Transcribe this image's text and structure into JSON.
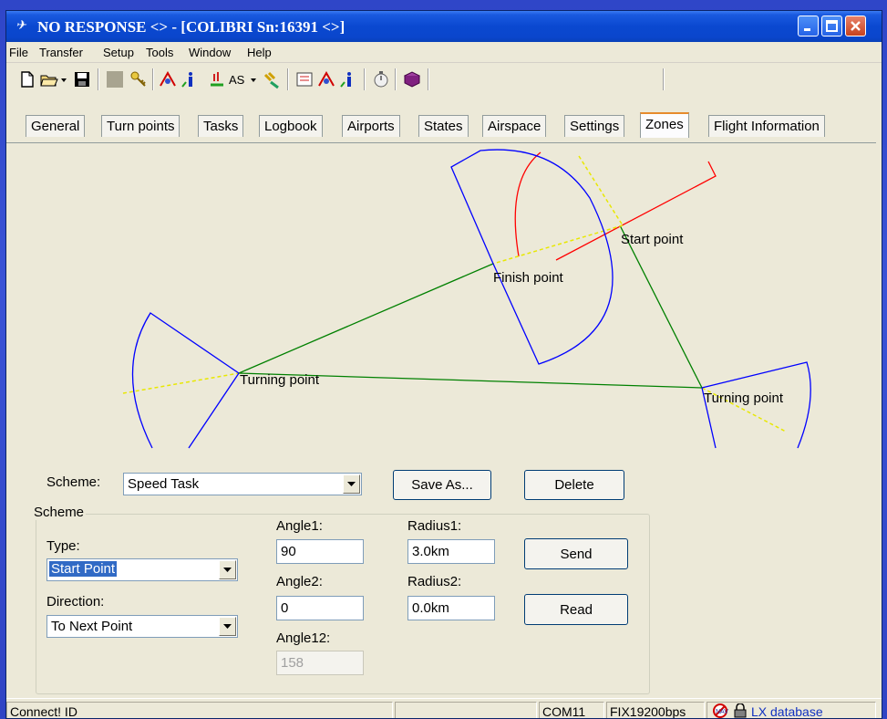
{
  "window": {
    "title": "NO RESPONSE    <> - [COLIBRI Sn:16391   <>]",
    "app_icon": "plane-icon"
  },
  "menu": [
    "File",
    "Transfer",
    "Setup",
    "Tools",
    "Window",
    "Help"
  ],
  "toolbar": {
    "icons": [
      "new-file-icon",
      "open-folder-icon",
      "save-icon",
      "stop-icon",
      "key-icon",
      "flight-download-icon",
      "info-icon",
      "declare-icon",
      "airspace-icon",
      "satellite-icon",
      "task-icon",
      "flight-upload-icon",
      "info2-icon",
      "stopwatch-icon",
      "book-icon"
    ],
    "as_label": "AS"
  },
  "tabs": [
    "General",
    "Turn points",
    "Tasks",
    "Logbook",
    "Airports",
    "States",
    "Airspace",
    "Settings",
    "Zones",
    "Flight Information"
  ],
  "active_tab": "Zones",
  "zones_diagram": {
    "labels": {
      "start": "Start point",
      "finish": "Finish point",
      "turn1": "Turning point",
      "turn2": "Turning point"
    },
    "colors": {
      "sector": "#0000ff",
      "start_line": "#ff0000",
      "leg": "#008000",
      "bisector": "#ffff00"
    }
  },
  "scheme_bar": {
    "label": "Scheme:",
    "value": "Speed Task",
    "save_as": "Save As...",
    "delete": "Delete"
  },
  "scheme_group": {
    "title": "Scheme",
    "type_label": "Type:",
    "type_value": "Start Point",
    "direction_label": "Direction:",
    "direction_value": "To Next Point",
    "angle1_label": "Angle1:",
    "angle1_value": "90",
    "angle2_label": "Angle2:",
    "angle2_value": "0",
    "angle12_label": "Angle12:",
    "angle12_value": "158",
    "radius1_label": "Radius1:",
    "radius1_value": "3.0km",
    "radius2_label": "Radius2:",
    "radius2_value": "0.0km",
    "send": "Send",
    "read": "Read"
  },
  "status": {
    "left": "Connect! ID",
    "port": "COM11",
    "baud": "FIX19200bps",
    "db": "LX database"
  }
}
